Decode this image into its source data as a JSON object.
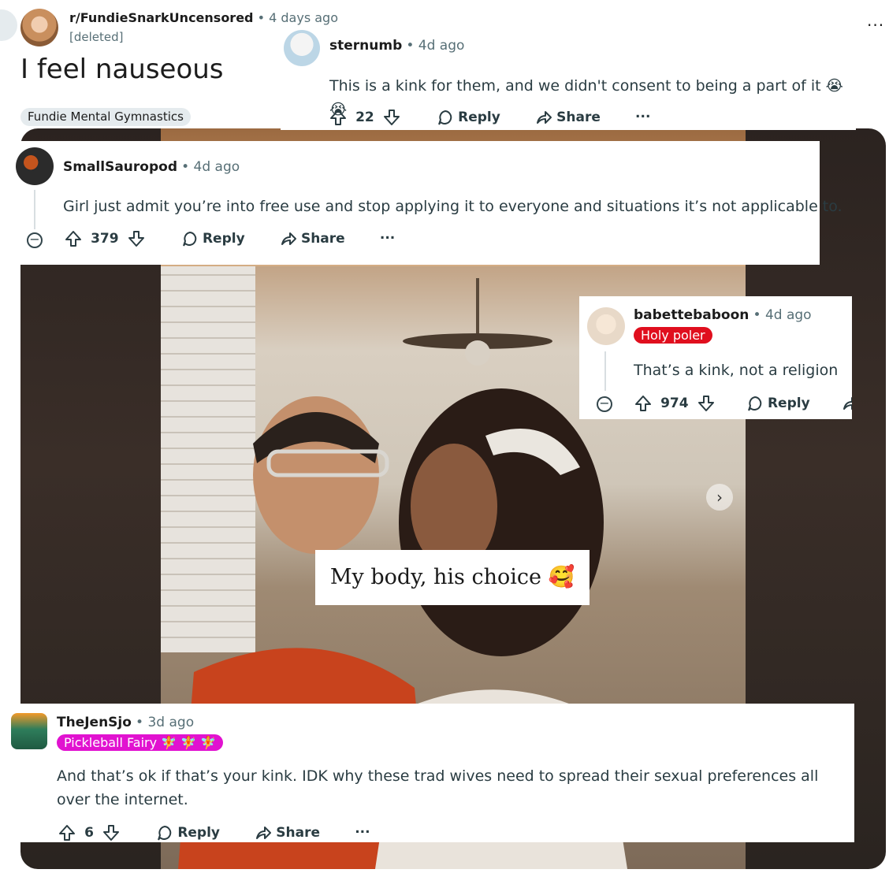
{
  "post": {
    "subreddit": "r/FundieSnarkUncensored",
    "age": "4 days ago",
    "author": "[deleted]",
    "title": "I feel nauseous",
    "flair": "Fundie Mental Gymnastics",
    "more": "···"
  },
  "media": {
    "caption": "My body, his choice 🥰",
    "next_icon": "chevron-right"
  },
  "comments": [
    {
      "user": "sternumb",
      "age": "4d ago",
      "text": "This is a kink for them, and we didn't consent to being a part of it 😭 😭",
      "votes": "22",
      "reply": "Reply",
      "share": "Share",
      "more": "···"
    },
    {
      "user": "SmallSauropod",
      "age": "4d ago",
      "text": "Girl just admit you’re into free use and stop applying it to everyone and situations it’s not applicable to.",
      "votes": "379",
      "reply": "Reply",
      "share": "Share",
      "more": "···"
    },
    {
      "user": "babettebaboon",
      "age": "4d ago",
      "flair": "Holy poler",
      "text": "That’s a kink, not a religion",
      "votes": "974",
      "reply": "Reply"
    },
    {
      "user": "TheJenSjo",
      "age": "3d ago",
      "flair": "Pickleball Fairy 🧚 🧚 🧚",
      "text": "And that’s ok if that’s your kink. IDK why these trad wives need to spread their sexual preferences all over the internet.",
      "votes": "6",
      "reply": "Reply",
      "share": "Share",
      "more": "···"
    }
  ],
  "colors": {
    "upvote_outline": "#2a3c42",
    "flair_red": "#e00f1e",
    "flair_pink": "#e112d0",
    "muted_text": "#576f76"
  }
}
